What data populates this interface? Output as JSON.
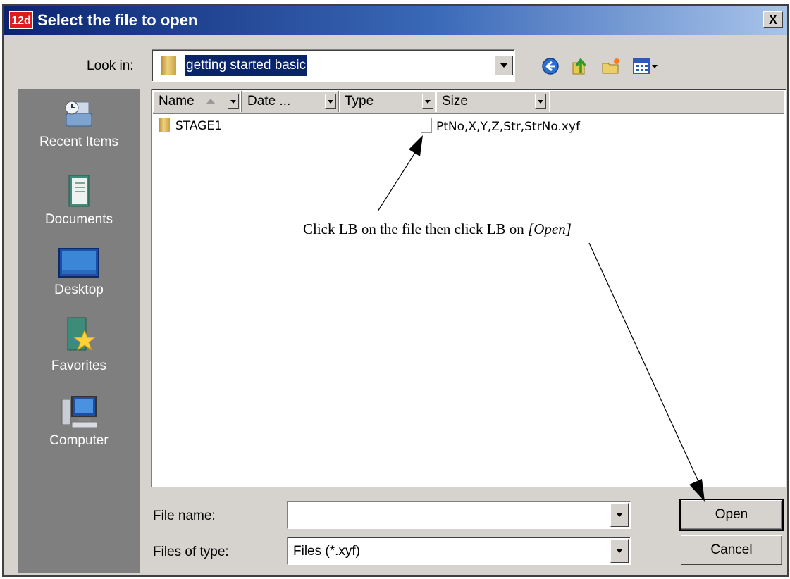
{
  "window": {
    "logo_text": "12d",
    "title": "Select the file to open",
    "close_label": "X"
  },
  "lookin": {
    "label": "Look in:",
    "value": "getting started basic"
  },
  "places": [
    {
      "label": "Recent Items",
      "icon": "recent-items-icon"
    },
    {
      "label": "Documents",
      "icon": "documents-icon"
    },
    {
      "label": "Desktop",
      "icon": "desktop-icon"
    },
    {
      "label": "Favorites",
      "icon": "favorites-icon"
    },
    {
      "label": "Computer",
      "icon": "computer-icon"
    }
  ],
  "columns": [
    "Name",
    "Date ...",
    "Type",
    "Size"
  ],
  "files": [
    {
      "name": "STAGE1",
      "icon": "folder-icon"
    },
    {
      "name": "PtNo,X,Y,Z,Str,StrNo.xyf",
      "icon": "file-icon"
    }
  ],
  "filename": {
    "label": "File name:",
    "value": ""
  },
  "filetype": {
    "label": "Files of type:",
    "value": "Files (*.xyf)"
  },
  "buttons": {
    "open": "Open",
    "cancel": "Cancel"
  },
  "annotation": {
    "text": "Click LB on the file then click LB on ",
    "emph": "[Open]"
  },
  "colors": {
    "title_start": "#0b2470",
    "title_end": "#a8c4ea",
    "dialog_bg": "#d6d3ce",
    "places_bg": "#7f7f7f",
    "selection": "#0a246a"
  }
}
